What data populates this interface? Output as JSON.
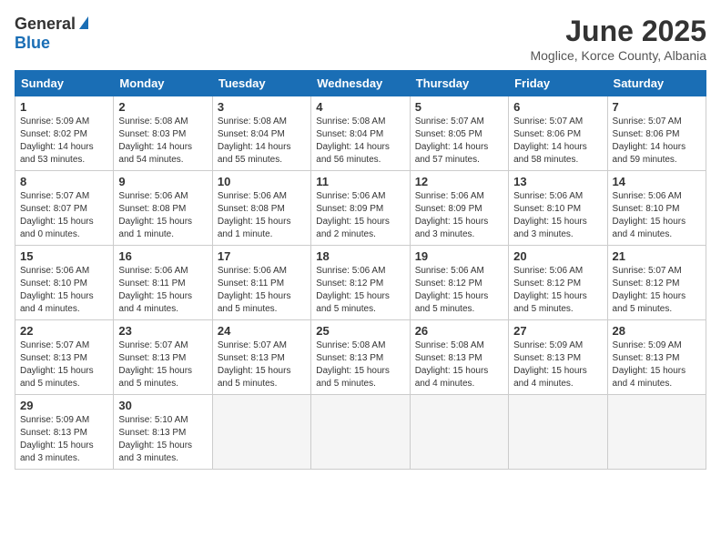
{
  "logo": {
    "general": "General",
    "blue": "Blue"
  },
  "title": {
    "month_year": "June 2025",
    "location": "Moglice, Korce County, Albania"
  },
  "days_of_week": [
    "Sunday",
    "Monday",
    "Tuesday",
    "Wednesday",
    "Thursday",
    "Friday",
    "Saturday"
  ],
  "weeks": [
    [
      {
        "day": "1",
        "info": "Sunrise: 5:09 AM\nSunset: 8:02 PM\nDaylight: 14 hours\nand 53 minutes."
      },
      {
        "day": "2",
        "info": "Sunrise: 5:08 AM\nSunset: 8:03 PM\nDaylight: 14 hours\nand 54 minutes."
      },
      {
        "day": "3",
        "info": "Sunrise: 5:08 AM\nSunset: 8:04 PM\nDaylight: 14 hours\nand 55 minutes."
      },
      {
        "day": "4",
        "info": "Sunrise: 5:08 AM\nSunset: 8:04 PM\nDaylight: 14 hours\nand 56 minutes."
      },
      {
        "day": "5",
        "info": "Sunrise: 5:07 AM\nSunset: 8:05 PM\nDaylight: 14 hours\nand 57 minutes."
      },
      {
        "day": "6",
        "info": "Sunrise: 5:07 AM\nSunset: 8:06 PM\nDaylight: 14 hours\nand 58 minutes."
      },
      {
        "day": "7",
        "info": "Sunrise: 5:07 AM\nSunset: 8:06 PM\nDaylight: 14 hours\nand 59 minutes."
      }
    ],
    [
      {
        "day": "8",
        "info": "Sunrise: 5:07 AM\nSunset: 8:07 PM\nDaylight: 15 hours\nand 0 minutes."
      },
      {
        "day": "9",
        "info": "Sunrise: 5:06 AM\nSunset: 8:08 PM\nDaylight: 15 hours\nand 1 minute."
      },
      {
        "day": "10",
        "info": "Sunrise: 5:06 AM\nSunset: 8:08 PM\nDaylight: 15 hours\nand 1 minute."
      },
      {
        "day": "11",
        "info": "Sunrise: 5:06 AM\nSunset: 8:09 PM\nDaylight: 15 hours\nand 2 minutes."
      },
      {
        "day": "12",
        "info": "Sunrise: 5:06 AM\nSunset: 8:09 PM\nDaylight: 15 hours\nand 3 minutes."
      },
      {
        "day": "13",
        "info": "Sunrise: 5:06 AM\nSunset: 8:10 PM\nDaylight: 15 hours\nand 3 minutes."
      },
      {
        "day": "14",
        "info": "Sunrise: 5:06 AM\nSunset: 8:10 PM\nDaylight: 15 hours\nand 4 minutes."
      }
    ],
    [
      {
        "day": "15",
        "info": "Sunrise: 5:06 AM\nSunset: 8:10 PM\nDaylight: 15 hours\nand 4 minutes."
      },
      {
        "day": "16",
        "info": "Sunrise: 5:06 AM\nSunset: 8:11 PM\nDaylight: 15 hours\nand 4 minutes."
      },
      {
        "day": "17",
        "info": "Sunrise: 5:06 AM\nSunset: 8:11 PM\nDaylight: 15 hours\nand 5 minutes."
      },
      {
        "day": "18",
        "info": "Sunrise: 5:06 AM\nSunset: 8:12 PM\nDaylight: 15 hours\nand 5 minutes."
      },
      {
        "day": "19",
        "info": "Sunrise: 5:06 AM\nSunset: 8:12 PM\nDaylight: 15 hours\nand 5 minutes."
      },
      {
        "day": "20",
        "info": "Sunrise: 5:06 AM\nSunset: 8:12 PM\nDaylight: 15 hours\nand 5 minutes."
      },
      {
        "day": "21",
        "info": "Sunrise: 5:07 AM\nSunset: 8:12 PM\nDaylight: 15 hours\nand 5 minutes."
      }
    ],
    [
      {
        "day": "22",
        "info": "Sunrise: 5:07 AM\nSunset: 8:13 PM\nDaylight: 15 hours\nand 5 minutes."
      },
      {
        "day": "23",
        "info": "Sunrise: 5:07 AM\nSunset: 8:13 PM\nDaylight: 15 hours\nand 5 minutes."
      },
      {
        "day": "24",
        "info": "Sunrise: 5:07 AM\nSunset: 8:13 PM\nDaylight: 15 hours\nand 5 minutes."
      },
      {
        "day": "25",
        "info": "Sunrise: 5:08 AM\nSunset: 8:13 PM\nDaylight: 15 hours\nand 5 minutes."
      },
      {
        "day": "26",
        "info": "Sunrise: 5:08 AM\nSunset: 8:13 PM\nDaylight: 15 hours\nand 4 minutes."
      },
      {
        "day": "27",
        "info": "Sunrise: 5:09 AM\nSunset: 8:13 PM\nDaylight: 15 hours\nand 4 minutes."
      },
      {
        "day": "28",
        "info": "Sunrise: 5:09 AM\nSunset: 8:13 PM\nDaylight: 15 hours\nand 4 minutes."
      }
    ],
    [
      {
        "day": "29",
        "info": "Sunrise: 5:09 AM\nSunset: 8:13 PM\nDaylight: 15 hours\nand 3 minutes."
      },
      {
        "day": "30",
        "info": "Sunrise: 5:10 AM\nSunset: 8:13 PM\nDaylight: 15 hours\nand 3 minutes."
      },
      {
        "day": "",
        "info": ""
      },
      {
        "day": "",
        "info": ""
      },
      {
        "day": "",
        "info": ""
      },
      {
        "day": "",
        "info": ""
      },
      {
        "day": "",
        "info": ""
      }
    ]
  ]
}
